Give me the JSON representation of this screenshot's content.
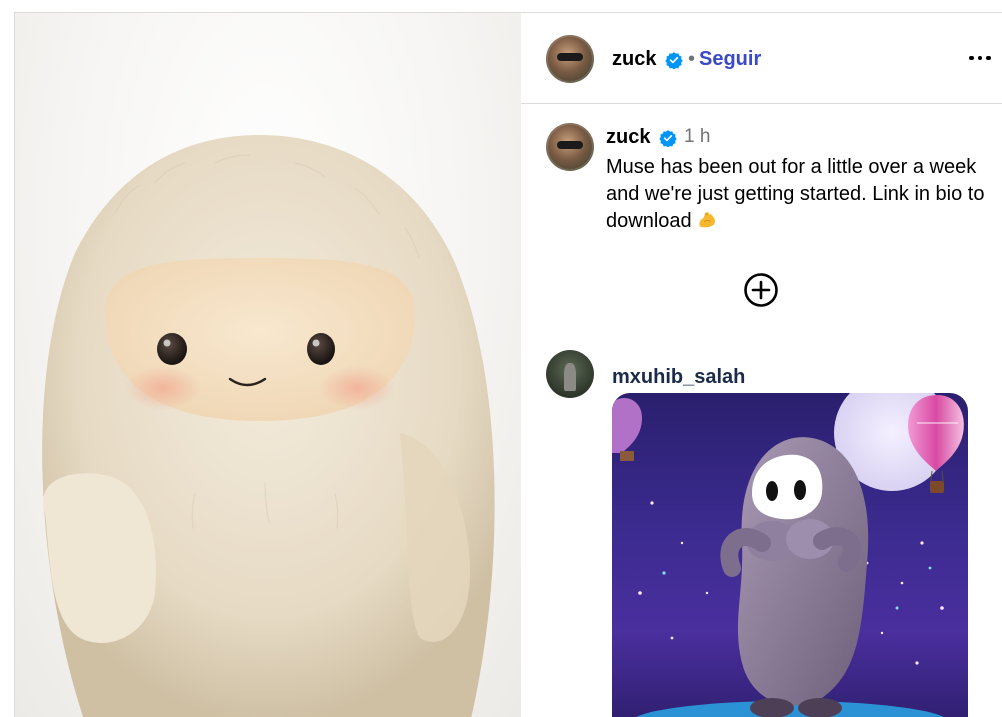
{
  "post": {
    "author": {
      "username": "zuck",
      "verified": true,
      "follow_label": "Seguir",
      "separator": "•"
    },
    "more_icon": "more-horizontal-icon",
    "caption": {
      "username": "zuck",
      "time": "1 h",
      "text": "Muse has been out for a little over a week and we're just getting started. Link in bio to download",
      "emoji": "flexed-biceps-emoji"
    },
    "expand_icon": "circle-plus-icon",
    "comments": [
      {
        "username": "mxuhib_salah",
        "attachment": "gif"
      }
    ]
  },
  "colors": {
    "follow": "#3949c9",
    "verified": "#0095f6",
    "border": "#dbdbdb",
    "muted": "#737373"
  }
}
